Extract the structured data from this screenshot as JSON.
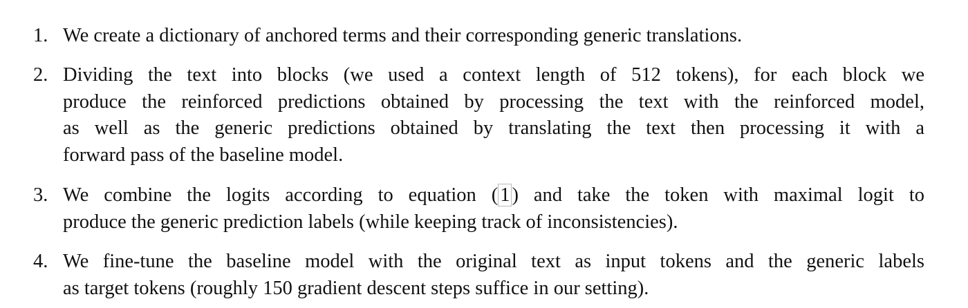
{
  "items": [
    {
      "number": "1.",
      "lines": [
        "We create a dictionary of anchored terms and their corresponding generic translations."
      ]
    },
    {
      "number": "2.",
      "lines": [
        "Dividing the text into blocks (we used a context length of 512 tokens), for each block we",
        "produce the reinforced predictions obtained by processing the text with the reinforced model,",
        "as well as the generic predictions obtained by translating the text then processing it with a",
        "forward pass of the baseline model."
      ]
    },
    {
      "number": "3.",
      "line1_pre": "We combine the logits according to equation (",
      "ref": "1",
      "line1_post": ") and take the token with maximal logit to",
      "lines": [
        "produce the generic prediction labels (while keeping track of inconsistencies)."
      ]
    },
    {
      "number": "4.",
      "lines": [
        "We fine-tune the baseline model with the original text as input tokens and the generic labels",
        "as target tokens (roughly 150 gradient descent steps suffice in our setting)."
      ]
    }
  ]
}
